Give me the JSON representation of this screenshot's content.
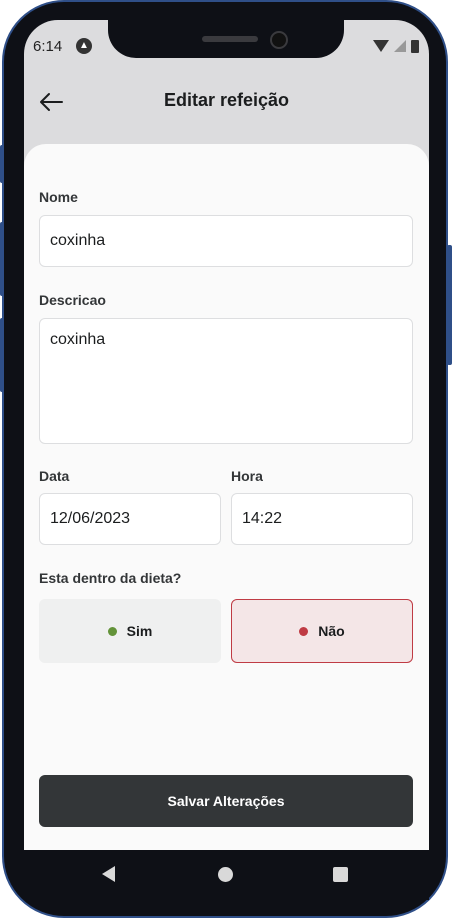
{
  "status_bar": {
    "time": "6:14",
    "notification_icon": "android-a-icon"
  },
  "header": {
    "title": "Editar refeição",
    "back_icon": "arrow-left-icon"
  },
  "form": {
    "name_label": "Nome",
    "name_value": "coxinha",
    "description_label": "Descricao",
    "description_value": "coxinha",
    "date_label": "Data",
    "date_value": "12/06/2023",
    "time_label": "Hora",
    "time_value": "14:22",
    "diet_question": "Esta dentro da dieta?",
    "options": [
      {
        "label": "Sim",
        "selected": false,
        "dot_color": "#639339"
      },
      {
        "label": "Não",
        "selected": true,
        "dot_color": "#bf3b44"
      }
    ]
  },
  "actions": {
    "save_label": "Salvar Alterações"
  },
  "colors": {
    "accent_dark": "#333638",
    "selected_bg": "#f4e6e7",
    "selected_border": "#bf3b44",
    "unselected_bg": "#eff0f0"
  }
}
